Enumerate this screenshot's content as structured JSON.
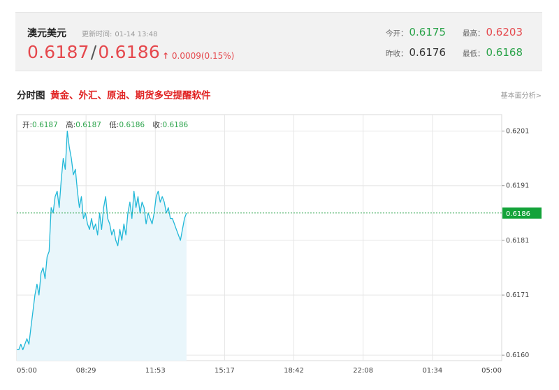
{
  "quote": {
    "name": "澳元美元",
    "update_label": "更新时间:",
    "update_time": "01-14 13:48",
    "bid": "0.6187",
    "separator": "/",
    "ask": "0.6186",
    "change_arrow": "↑",
    "change": "0.0009(0.15%)",
    "open_label": "今开：",
    "open": "0.6175",
    "high_label": "最高：",
    "high": "0.6203",
    "prev_close_label": "昨收：",
    "prev_close": "0.6176",
    "low_label": "最低：",
    "low": "0.6168"
  },
  "section": {
    "title": "分时图",
    "promo": "黄金、外汇、原油、期货多空提醒软件",
    "analysis_link": "基本面分析>"
  },
  "ohlc": {
    "open_label": "开:",
    "open": "0.6187",
    "high_label": "高:",
    "high": "0.6187",
    "low_label": "低:",
    "low": "0.6186",
    "close_label": "收:",
    "close": "0.6186"
  },
  "colors": {
    "up": "#e5484d",
    "down": "#2aa34a",
    "line": "#22b8d8",
    "area": "#e9f6fb",
    "current_price_bg": "#14a33a"
  },
  "chart_data": {
    "type": "area",
    "x_ticks": [
      "05:00",
      "08:29",
      "11:53",
      "15:17",
      "18:42",
      "22:08",
      "01:34",
      "05:00"
    ],
    "y_ticks": [
      0.616,
      0.6171,
      0.6181,
      0.6191,
      0.6201
    ],
    "y_tick_labels": [
      "0.6160",
      "0.6171",
      "0.6181",
      "0.6191",
      "0.6201"
    ],
    "ylim": [
      0.6159,
      0.6204
    ],
    "x_range_minutes": [
      0,
      1440
    ],
    "current_price": 0.6186,
    "current_price_label": "0.6186",
    "reference_line": 0.6186,
    "grid": true,
    "x_minutes": [
      0,
      6,
      12,
      18,
      24,
      30,
      36,
      42,
      48,
      54,
      60,
      66,
      72,
      78,
      84,
      90,
      96,
      102,
      108,
      114,
      120,
      126,
      132,
      138,
      144,
      150,
      156,
      162,
      168,
      174,
      180,
      186,
      192,
      198,
      204,
      210,
      216,
      222,
      228,
      234,
      240,
      246,
      252,
      258,
      264,
      270,
      276,
      282,
      288,
      294,
      300,
      306,
      312,
      318,
      324,
      330,
      336,
      342,
      348,
      354,
      360,
      366,
      372,
      378,
      384,
      390,
      396,
      402,
      408,
      414,
      420,
      426,
      432,
      438,
      444,
      450,
      456,
      462,
      468,
      474,
      480,
      486,
      492,
      498,
      504
    ],
    "values": [
      0.6161,
      0.6161,
      0.6162,
      0.6161,
      0.6162,
      0.6163,
      0.6162,
      0.6165,
      0.6168,
      0.6171,
      0.6173,
      0.6171,
      0.6175,
      0.6176,
      0.6174,
      0.6178,
      0.6179,
      0.6187,
      0.6186,
      0.6189,
      0.619,
      0.6187,
      0.6192,
      0.6196,
      0.6194,
      0.6201,
      0.6198,
      0.6196,
      0.6193,
      0.6194,
      0.619,
      0.6187,
      0.6189,
      0.6185,
      0.6186,
      0.6184,
      0.6183,
      0.6185,
      0.6183,
      0.6184,
      0.6182,
      0.6186,
      0.6183,
      0.6187,
      0.6189,
      0.6185,
      0.6184,
      0.6182,
      0.6183,
      0.6181,
      0.618,
      0.6183,
      0.6181,
      0.6184,
      0.6182,
      0.6186,
      0.6188,
      0.6185,
      0.619,
      0.6187,
      0.6189,
      0.6186,
      0.6188,
      0.6187,
      0.6184,
      0.6186,
      0.6185,
      0.6184,
      0.6186,
      0.6189,
      0.619,
      0.6188,
      0.6189,
      0.6188,
      0.6186,
      0.6187,
      0.6185,
      0.6185,
      0.6184,
      0.6183,
      0.6182,
      0.6181,
      0.6183,
      0.6185,
      0.6186
    ]
  }
}
